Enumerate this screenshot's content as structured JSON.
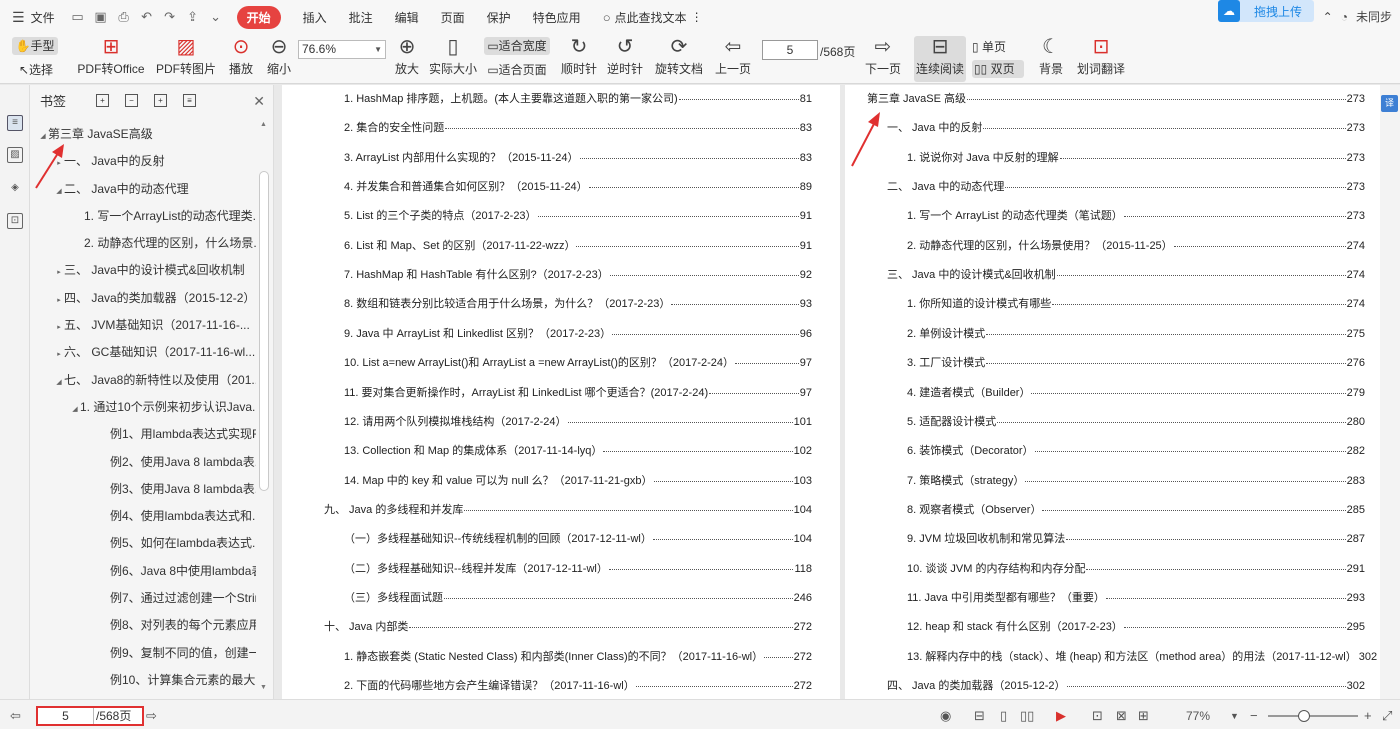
{
  "menu": {
    "file": "文件",
    "tabs": [
      "开始",
      "插入",
      "批注",
      "编辑",
      "页面",
      "保护",
      "特色应用"
    ],
    "active_tab": "开始",
    "search_placeholder": "点此查找文本",
    "upload_label": "拖拽上传",
    "user_label": "未同步"
  },
  "toolbar": {
    "hand": "手型",
    "select": "选择",
    "pdf_to_office": "PDF转Office",
    "pdf_to_image": "PDF转图片",
    "play": "播放",
    "zoom_out": "缩小",
    "zoom_value": "76.6%",
    "zoom_in": "放大",
    "actual_size": "实际大小",
    "fit_width": "适合宽度",
    "fit_page": "适合页面",
    "rotate_cw": "顺时针",
    "rotate_ccw": "逆时针",
    "rotate_doc": "旋转文档",
    "prev_page": "上一页",
    "page_current": "5",
    "page_total": "/568页",
    "next_page": "下一页",
    "continuous": "连续阅读",
    "single": "单页",
    "double": "双页",
    "background": "背景",
    "translate": "划词翻译"
  },
  "sidebar": {
    "title": "书签",
    "items": [
      {
        "label": "第三章  JavaSE高级",
        "arrow": "◢",
        "indent": 8
      },
      {
        "label": "一、 Java中的反射",
        "arrow": "▸",
        "indent": 24
      },
      {
        "label": "二、 Java中的动态代理",
        "arrow": "◢",
        "indent": 24
      },
      {
        "label": "1. 写一个ArrayList的动态代理类...",
        "arrow": "",
        "indent": 44
      },
      {
        "label": "2. 动静态代理的区别，什么场景...",
        "arrow": "",
        "indent": 44
      },
      {
        "label": "三、 Java中的设计模式&回收机制",
        "arrow": "▸",
        "indent": 24
      },
      {
        "label": "四、 Java的类加载器（2015-12-2）",
        "arrow": "▸",
        "indent": 24
      },
      {
        "label": "五、 JVM基础知识（2017-11-16-...",
        "arrow": "▸",
        "indent": 24
      },
      {
        "label": "六、 GC基础知识（2017-11-16-wl...",
        "arrow": "▸",
        "indent": 24
      },
      {
        "label": "七、 Java8的新特性以及使用（201...",
        "arrow": "◢",
        "indent": 24
      },
      {
        "label": "1. 通过10个示例来初步认识Java...",
        "arrow": "◢",
        "indent": 40
      },
      {
        "label": "例1、用lambda表达式实现R...",
        "arrow": "",
        "indent": 70
      },
      {
        "label": "例2、使用Java 8 lambda表...",
        "arrow": "",
        "indent": 70
      },
      {
        "label": "例3、使用Java 8 lambda表...",
        "arrow": "",
        "indent": 70
      },
      {
        "label": "例4、使用lambda表达式和...",
        "arrow": "",
        "indent": 70
      },
      {
        "label": "例5、如何在lambda表达式...",
        "arrow": "",
        "indent": 70
      },
      {
        "label": "例6、Java 8中使用lambda表...",
        "arrow": "",
        "indent": 70
      },
      {
        "label": "例7、通过过滤创建一个Strin...",
        "arrow": "",
        "indent": 70
      },
      {
        "label": "例8、对列表的每个元素应用...",
        "arrow": "",
        "indent": 70
      },
      {
        "label": "例9、复制不同的值，创建一...",
        "arrow": "",
        "indent": 70
      },
      {
        "label": "例10、计算集合元素的最大...",
        "arrow": "",
        "indent": 70
      }
    ]
  },
  "left_page": [
    {
      "t": "1. HashMap 排序题，上机题。(本人主要靠这道题入职的第一家公司)",
      "p": "81",
      "x": 62
    },
    {
      "t": "2. 集合的安全性问题",
      "p": "83",
      "x": 62
    },
    {
      "t": "3. ArrayList 内部用什么实现的？（2015-11-24）",
      "p": "83",
      "x": 62
    },
    {
      "t": "4. 并发集合和普通集合如何区别？（2015-11-24）",
      "p": "89",
      "x": 62
    },
    {
      "t": "5. List 的三个子类的特点（2017-2-23）",
      "p": "91",
      "x": 62
    },
    {
      "t": "6. List 和 Map、Set 的区别（2017-11-22-wzz）",
      "p": "91",
      "x": 62
    },
    {
      "t": "7. HashMap 和 HashTable 有什么区别?（2017-2-23）",
      "p": "92",
      "x": 62
    },
    {
      "t": "8. 数组和链表分别比较适合用于什么场景，为什么？（2017-2-23）",
      "p": "93",
      "x": 62
    },
    {
      "t": "9. Java 中 ArrayList 和 Linkedlist 区别？（2017-2-23）",
      "p": "96",
      "x": 62
    },
    {
      "t": "10. List a=new ArrayList()和 ArrayList a =new ArrayList()的区别？（2017-2-24）",
      "p": "97",
      "x": 62
    },
    {
      "t": "11. 要对集合更新操作时，ArrayList 和 LinkedList 哪个更适合？(2017-2-24)",
      "p": "97",
      "x": 62
    },
    {
      "t": "12. 请用两个队列模拟堆栈结构（2017-2-24）",
      "p": "101",
      "x": 62
    },
    {
      "t": "13. Collection 和 Map 的集成体系（2017-11-14-lyq）",
      "p": "102",
      "x": 62
    },
    {
      "t": "14. Map 中的 key 和 value 可以为 null 么？（2017-11-21-gxb）",
      "p": "103",
      "x": 62
    },
    {
      "t": "九、  Java 的多线程和并发库",
      "p": "104",
      "x": 42
    },
    {
      "t": "（一）多线程基础知识--传统线程机制的回顾（2017-12-11-wl）",
      "p": "104",
      "x": 62
    },
    {
      "t": "（二）多线程基础知识--线程并发库（2017-12-11-wl）",
      "p": "118",
      "x": 62
    },
    {
      "t": "（三）多线程面试题",
      "p": "246",
      "x": 62
    },
    {
      "t": "十、  Java 内部类",
      "p": "272",
      "x": 42
    },
    {
      "t": "1. 静态嵌套类 (Static Nested Class) 和内部类(Inner Class)的不同？（2017-11-16-wl）",
      "p": "272",
      "x": 62
    },
    {
      "t": "2. 下面的代码哪些地方会产生编译错误？（2017-11-16-wl）",
      "p": "272",
      "x": 62
    }
  ],
  "right_page": [
    {
      "t": "第三章  JavaSE 高级",
      "p": "273",
      "x": 22
    },
    {
      "t": "一、  Java 中的反射",
      "p": "273",
      "x": 42
    },
    {
      "t": "1. 说说你对 Java 中反射的理解",
      "p": "273",
      "x": 62
    },
    {
      "t": "二、  Java 中的动态代理",
      "p": "273",
      "x": 42
    },
    {
      "t": "1. 写一个 ArrayList 的动态代理类（笔试题）",
      "p": "273",
      "x": 62
    },
    {
      "t": "2. 动静态代理的区别，什么场景使用？（2015-11-25）",
      "p": "274",
      "x": 62
    },
    {
      "t": "三、  Java 中的设计模式&回收机制",
      "p": "274",
      "x": 42
    },
    {
      "t": "1. 你所知道的设计模式有哪些",
      "p": "274",
      "x": 62
    },
    {
      "t": "2. 单例设计模式",
      "p": "275",
      "x": 62
    },
    {
      "t": "3. 工厂设计模式",
      "p": "276",
      "x": 62
    },
    {
      "t": "4. 建造者模式（Builder）",
      "p": "279",
      "x": 62
    },
    {
      "t": "5. 适配器设计模式",
      "p": "280",
      "x": 62
    },
    {
      "t": "6. 装饰模式（Decorator）",
      "p": "282",
      "x": 62
    },
    {
      "t": "7. 策略模式（strategy）",
      "p": "283",
      "x": 62
    },
    {
      "t": "8. 观察者模式（Observer）",
      "p": "285",
      "x": 62
    },
    {
      "t": "9. JVM 垃圾回收机制和常见算法",
      "p": "287",
      "x": 62
    },
    {
      "t": "10. 谈谈 JVM 的内存结构和内存分配",
      "p": "291",
      "x": 62
    },
    {
      "t": "11. Java 中引用类型都有哪些？（重要）",
      "p": "293",
      "x": 62
    },
    {
      "t": "12. heap 和 stack 有什么区别（2017-2-23）",
      "p": "295",
      "x": 62
    },
    {
      "t": "13. 解释内存中的栈（stack）、堆 (heap) 和方法区（method area）的用法（2017-11-12-wl）",
      "p": "302",
      "x": 62
    },
    {
      "t": "四、  Java 的类加载器（2015-12-2）",
      "p": "302",
      "x": 42
    }
  ],
  "statusbar": {
    "page_current": "5",
    "page_total": "/568页",
    "zoom": "77%"
  },
  "colors": {
    "accent_red": "#e64340",
    "annotation_red": "#e03030",
    "upload_blue": "#1e88e5"
  }
}
